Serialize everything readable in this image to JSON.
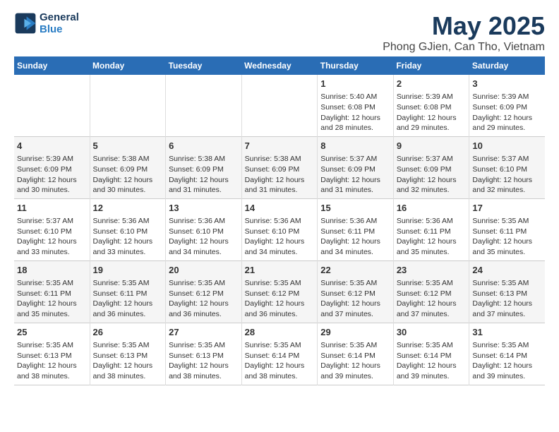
{
  "header": {
    "logo_line1": "General",
    "logo_line2": "Blue",
    "title": "May 2025",
    "subtitle": "Phong GJien, Can Tho, Vietnam"
  },
  "days_of_week": [
    "Sunday",
    "Monday",
    "Tuesday",
    "Wednesday",
    "Thursday",
    "Friday",
    "Saturday"
  ],
  "weeks": [
    {
      "days": [
        {
          "num": "",
          "info": ""
        },
        {
          "num": "",
          "info": ""
        },
        {
          "num": "",
          "info": ""
        },
        {
          "num": "",
          "info": ""
        },
        {
          "num": "1",
          "info": "Sunrise: 5:40 AM\nSunset: 6:08 PM\nDaylight: 12 hours\nand 28 minutes."
        },
        {
          "num": "2",
          "info": "Sunrise: 5:39 AM\nSunset: 6:08 PM\nDaylight: 12 hours\nand 29 minutes."
        },
        {
          "num": "3",
          "info": "Sunrise: 5:39 AM\nSunset: 6:09 PM\nDaylight: 12 hours\nand 29 minutes."
        }
      ]
    },
    {
      "days": [
        {
          "num": "4",
          "info": "Sunrise: 5:39 AM\nSunset: 6:09 PM\nDaylight: 12 hours\nand 30 minutes."
        },
        {
          "num": "5",
          "info": "Sunrise: 5:38 AM\nSunset: 6:09 PM\nDaylight: 12 hours\nand 30 minutes."
        },
        {
          "num": "6",
          "info": "Sunrise: 5:38 AM\nSunset: 6:09 PM\nDaylight: 12 hours\nand 31 minutes."
        },
        {
          "num": "7",
          "info": "Sunrise: 5:38 AM\nSunset: 6:09 PM\nDaylight: 12 hours\nand 31 minutes."
        },
        {
          "num": "8",
          "info": "Sunrise: 5:37 AM\nSunset: 6:09 PM\nDaylight: 12 hours\nand 31 minutes."
        },
        {
          "num": "9",
          "info": "Sunrise: 5:37 AM\nSunset: 6:09 PM\nDaylight: 12 hours\nand 32 minutes."
        },
        {
          "num": "10",
          "info": "Sunrise: 5:37 AM\nSunset: 6:10 PM\nDaylight: 12 hours\nand 32 minutes."
        }
      ]
    },
    {
      "days": [
        {
          "num": "11",
          "info": "Sunrise: 5:37 AM\nSunset: 6:10 PM\nDaylight: 12 hours\nand 33 minutes."
        },
        {
          "num": "12",
          "info": "Sunrise: 5:36 AM\nSunset: 6:10 PM\nDaylight: 12 hours\nand 33 minutes."
        },
        {
          "num": "13",
          "info": "Sunrise: 5:36 AM\nSunset: 6:10 PM\nDaylight: 12 hours\nand 34 minutes."
        },
        {
          "num": "14",
          "info": "Sunrise: 5:36 AM\nSunset: 6:10 PM\nDaylight: 12 hours\nand 34 minutes."
        },
        {
          "num": "15",
          "info": "Sunrise: 5:36 AM\nSunset: 6:11 PM\nDaylight: 12 hours\nand 34 minutes."
        },
        {
          "num": "16",
          "info": "Sunrise: 5:36 AM\nSunset: 6:11 PM\nDaylight: 12 hours\nand 35 minutes."
        },
        {
          "num": "17",
          "info": "Sunrise: 5:35 AM\nSunset: 6:11 PM\nDaylight: 12 hours\nand 35 minutes."
        }
      ]
    },
    {
      "days": [
        {
          "num": "18",
          "info": "Sunrise: 5:35 AM\nSunset: 6:11 PM\nDaylight: 12 hours\nand 35 minutes."
        },
        {
          "num": "19",
          "info": "Sunrise: 5:35 AM\nSunset: 6:11 PM\nDaylight: 12 hours\nand 36 minutes."
        },
        {
          "num": "20",
          "info": "Sunrise: 5:35 AM\nSunset: 6:12 PM\nDaylight: 12 hours\nand 36 minutes."
        },
        {
          "num": "21",
          "info": "Sunrise: 5:35 AM\nSunset: 6:12 PM\nDaylight: 12 hours\nand 36 minutes."
        },
        {
          "num": "22",
          "info": "Sunrise: 5:35 AM\nSunset: 6:12 PM\nDaylight: 12 hours\nand 37 minutes."
        },
        {
          "num": "23",
          "info": "Sunrise: 5:35 AM\nSunset: 6:12 PM\nDaylight: 12 hours\nand 37 minutes."
        },
        {
          "num": "24",
          "info": "Sunrise: 5:35 AM\nSunset: 6:13 PM\nDaylight: 12 hours\nand 37 minutes."
        }
      ]
    },
    {
      "days": [
        {
          "num": "25",
          "info": "Sunrise: 5:35 AM\nSunset: 6:13 PM\nDaylight: 12 hours\nand 38 minutes."
        },
        {
          "num": "26",
          "info": "Sunrise: 5:35 AM\nSunset: 6:13 PM\nDaylight: 12 hours\nand 38 minutes."
        },
        {
          "num": "27",
          "info": "Sunrise: 5:35 AM\nSunset: 6:13 PM\nDaylight: 12 hours\nand 38 minutes."
        },
        {
          "num": "28",
          "info": "Sunrise: 5:35 AM\nSunset: 6:14 PM\nDaylight: 12 hours\nand 38 minutes."
        },
        {
          "num": "29",
          "info": "Sunrise: 5:35 AM\nSunset: 6:14 PM\nDaylight: 12 hours\nand 39 minutes."
        },
        {
          "num": "30",
          "info": "Sunrise: 5:35 AM\nSunset: 6:14 PM\nDaylight: 12 hours\nand 39 minutes."
        },
        {
          "num": "31",
          "info": "Sunrise: 5:35 AM\nSunset: 6:14 PM\nDaylight: 12 hours\nand 39 minutes."
        }
      ]
    }
  ]
}
